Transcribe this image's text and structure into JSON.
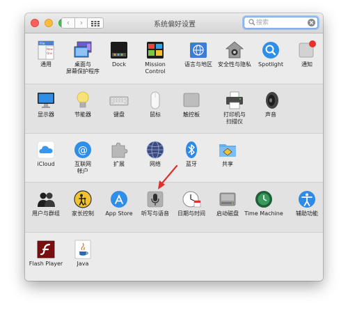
{
  "window": {
    "title": "系统偏好设置"
  },
  "toolbar": {
    "back": "‹",
    "forward": "›"
  },
  "search": {
    "placeholder": "搜索",
    "value": ""
  },
  "rows": [
    [
      {
        "id": "general",
        "label": "通用",
        "icon": "general-icon"
      },
      {
        "id": "desktop",
        "label": "桌面与\n屏幕保护程序",
        "icon": "desktop-icon"
      },
      {
        "id": "dock",
        "label": "Dock",
        "icon": "dock-icon"
      },
      {
        "id": "mission-control",
        "label": "Mission\nControl",
        "icon": "mission-control-icon"
      },
      {
        "id": "language",
        "label": "语言与地区",
        "icon": "language-flag-icon"
      },
      {
        "id": "security",
        "label": "安全性与隐私",
        "icon": "security-house-icon"
      },
      {
        "id": "spotlight",
        "label": "Spotlight",
        "icon": "spotlight-magnifier-icon"
      },
      {
        "id": "notifications",
        "label": "通知",
        "icon": "notifications-icon"
      }
    ],
    [
      {
        "id": "displays",
        "label": "显示器",
        "icon": "display-icon"
      },
      {
        "id": "energy",
        "label": "节能器",
        "icon": "lightbulb-icon"
      },
      {
        "id": "keyboard",
        "label": "键盘",
        "icon": "keyboard-icon"
      },
      {
        "id": "mouse",
        "label": "鼠标",
        "icon": "mouse-icon"
      },
      {
        "id": "trackpad",
        "label": "触控板",
        "icon": "trackpad-icon"
      },
      {
        "id": "printers",
        "label": "打印机与\n扫描仪",
        "icon": "printer-icon"
      },
      {
        "id": "sound",
        "label": "声音",
        "icon": "speaker-icon"
      }
    ],
    [
      {
        "id": "icloud",
        "label": "iCloud",
        "icon": "icloud-icon"
      },
      {
        "id": "internet-accounts",
        "label": "互联网\n帐户",
        "icon": "at-sign-icon"
      },
      {
        "id": "extensions",
        "label": "扩展",
        "icon": "puzzle-icon"
      },
      {
        "id": "network",
        "label": "网络",
        "icon": "globe-icon"
      },
      {
        "id": "bluetooth",
        "label": "蓝牙",
        "icon": "bluetooth-icon"
      },
      {
        "id": "sharing",
        "label": "共享",
        "icon": "sharing-folder-icon"
      }
    ],
    [
      {
        "id": "users",
        "label": "用户与群组",
        "icon": "users-icon"
      },
      {
        "id": "parental",
        "label": "家长控制",
        "icon": "parental-controls-icon"
      },
      {
        "id": "appstore",
        "label": "App Store",
        "icon": "app-store-icon"
      },
      {
        "id": "dictation",
        "label": "听写与语音",
        "icon": "microphone-icon"
      },
      {
        "id": "datetime",
        "label": "日期与时间",
        "icon": "clock-icon"
      },
      {
        "id": "startup",
        "label": "启动磁盘",
        "icon": "startup-disk-icon"
      },
      {
        "id": "timemachine",
        "label": "Time Machine",
        "icon": "time-machine-icon"
      },
      {
        "id": "accessibility",
        "label": "辅助功能",
        "icon": "accessibility-icon"
      }
    ],
    [
      {
        "id": "flash",
        "label": "Flash Player",
        "icon": "flash-player-icon"
      },
      {
        "id": "java",
        "label": "Java",
        "icon": "java-icon"
      }
    ]
  ],
  "general_icon_text": [
    "File",
    "New",
    "One"
  ],
  "annotation": {
    "arrow_color": "#e0302a"
  }
}
